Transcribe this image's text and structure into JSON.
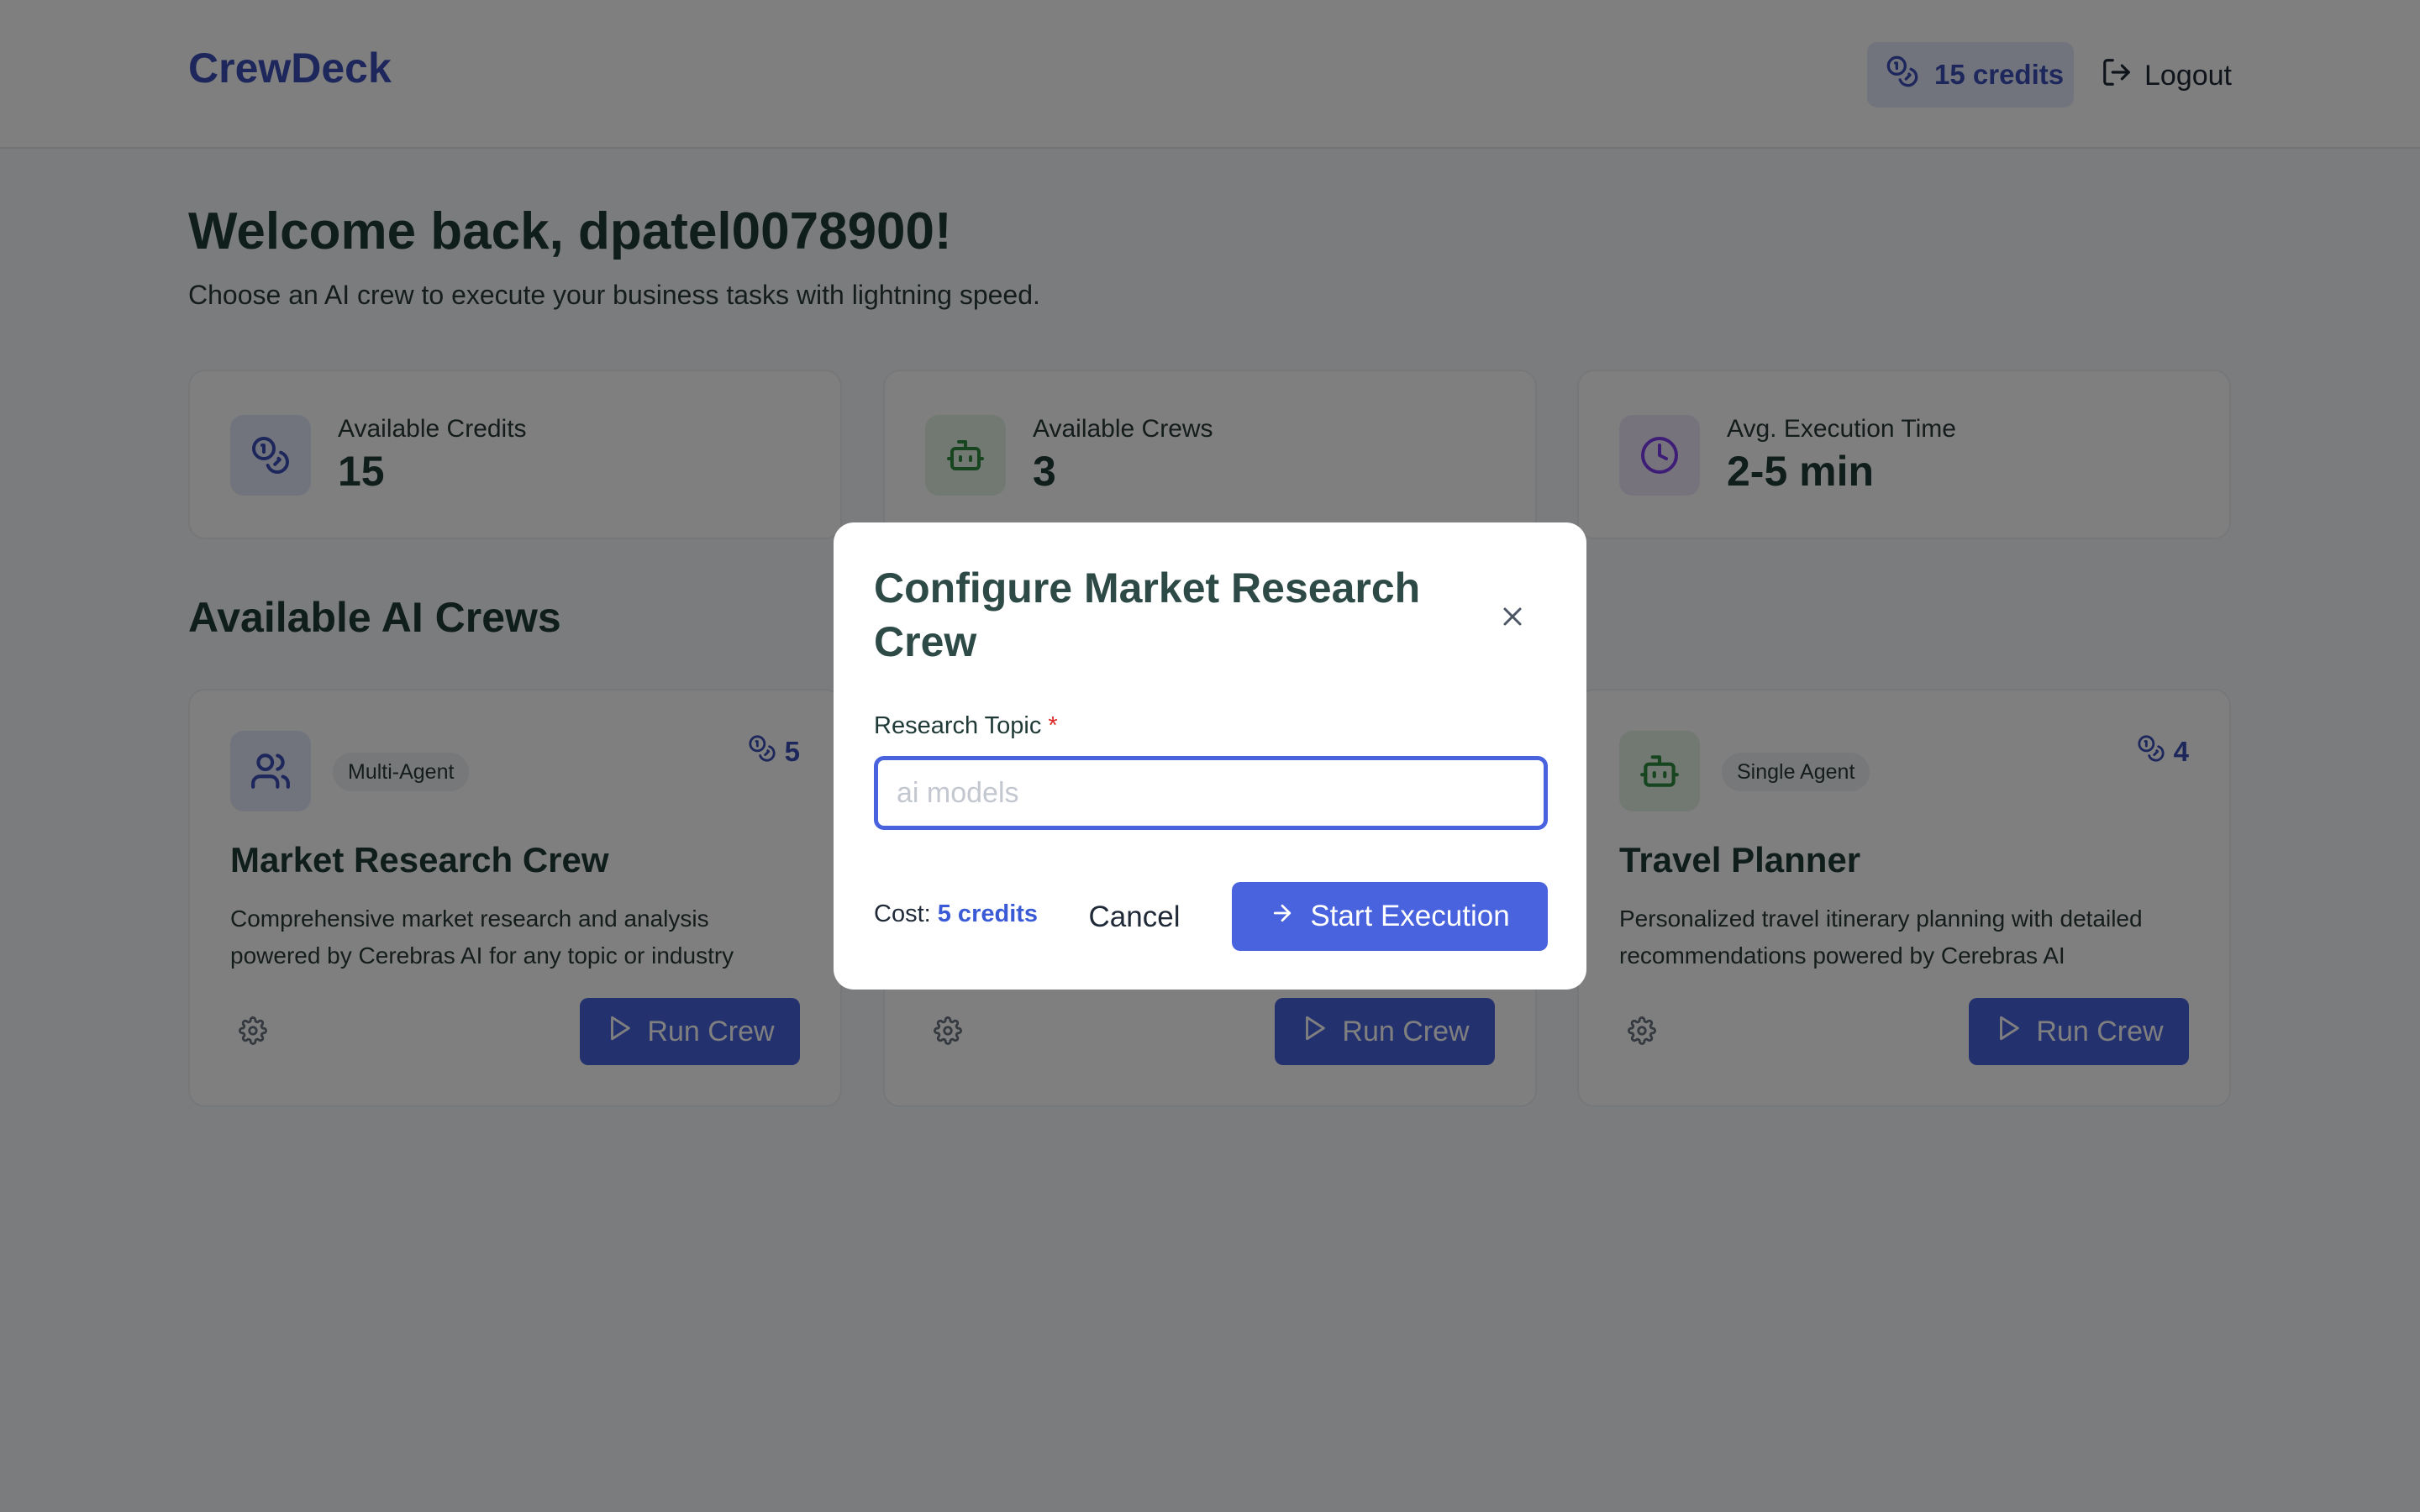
{
  "header": {
    "brand": "CrewDeck",
    "credits_label": "15 credits",
    "logout_label": "Logout"
  },
  "welcome": {
    "title": "Welcome back, dpatel0078900!",
    "subtitle": "Choose an AI crew to execute your business tasks with lightning speed."
  },
  "stats": [
    {
      "label": "Available Credits",
      "value": "15",
      "icon": "coins-icon"
    },
    {
      "label": "Available Crews",
      "value": "3",
      "icon": "robot-icon"
    },
    {
      "label": "Avg. Execution Time",
      "value": "2-5 min",
      "icon": "clock-icon"
    }
  ],
  "section_title": "Available AI Crews",
  "crews": [
    {
      "badge": "Multi-Agent",
      "cost": "5",
      "name": "Market Research Crew",
      "description": "Comprehensive market research and analysis powered by Cerebras AI for any topic or industry",
      "run_label": "Run Crew",
      "icon": "users-icon"
    },
    {
      "badge": "",
      "cost": "",
      "name": "",
      "description": "",
      "run_label": "Run Crew",
      "icon": ""
    },
    {
      "badge": "Single Agent",
      "cost": "4",
      "name": "Travel Planner",
      "description": "Personalized travel itinerary planning with detailed recommendations powered by Cerebras AI",
      "run_label": "Run Crew",
      "icon": "robot-icon"
    }
  ],
  "modal": {
    "title": "Configure Market Research Crew",
    "field_label": "Research Topic",
    "required_mark": "*",
    "placeholder": "ai models",
    "cost_prefix": "Cost:",
    "cost_value": "5 credits",
    "cancel_label": "Cancel",
    "start_label": "Start Execution"
  },
  "colors": {
    "brand": "#3b4fb8",
    "primary_button": "#4963df",
    "overlay": "rgba(0,0,0,0.5)"
  }
}
